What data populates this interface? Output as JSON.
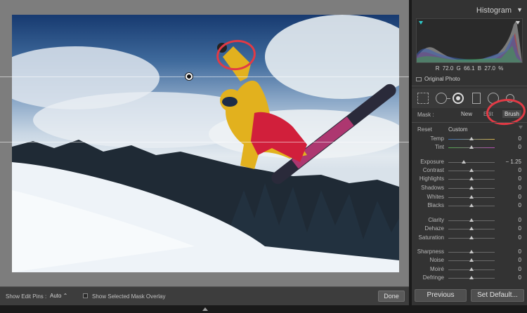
{
  "histogram": {
    "title": "Histogram",
    "toggle_icon": "triangle-down-icon",
    "r_label": "R",
    "r_value": "72.0",
    "g_label": "G",
    "g_value": "66.1",
    "b_label": "B",
    "b_value": "27.0",
    "unit": "%",
    "original_photo_label": "Original Photo"
  },
  "tools": [
    "crop-overlay-icon",
    "spot-removal-icon",
    "red-eye-icon",
    "graduated-filter-icon",
    "radial-filter-icon",
    "adjustment-brush-icon"
  ],
  "mask": {
    "label": "Mask :",
    "new": "New",
    "edit": "Edit",
    "brush": "Brush"
  },
  "adjust": {
    "reset_label": "Reset",
    "preset_value": "Custom",
    "sliders": [
      {
        "label": "Temp",
        "value": "0",
        "pos": 0.5
      },
      {
        "label": "Tint",
        "value": "0",
        "pos": 0.5
      },
      {
        "label": "Exposure",
        "value": "− 1.25",
        "pos": 0.34
      },
      {
        "label": "Contrast",
        "value": "0",
        "pos": 0.5
      },
      {
        "label": "Highlights",
        "value": "0",
        "pos": 0.5
      },
      {
        "label": "Shadows",
        "value": "0",
        "pos": 0.5
      },
      {
        "label": "Whites",
        "value": "0",
        "pos": 0.5
      },
      {
        "label": "Blacks",
        "value": "0",
        "pos": 0.5
      },
      {
        "label": "Clarity",
        "value": "0",
        "pos": 0.5
      },
      {
        "label": "Dehaze",
        "value": "0",
        "pos": 0.5
      },
      {
        "label": "Saturation",
        "value": "0",
        "pos": 0.5
      },
      {
        "label": "Sharpness",
        "value": "0",
        "pos": 0.5
      },
      {
        "label": "Noise",
        "value": "0",
        "pos": 0.5
      },
      {
        "label": "Moiré",
        "value": "0",
        "pos": 0.5
      },
      {
        "label": "Defringe",
        "value": "0",
        "pos": 0.5
      }
    ]
  },
  "toolbar": {
    "show_edit_pins_label": "Show Edit Pins :",
    "show_edit_pins_value": "Auto ⌃",
    "show_mask_overlay_label": "Show Selected Mask Overlay",
    "done_label": "Done"
  },
  "panel_buttons": {
    "previous_label": "Previous",
    "set_default_label": "Set Default..."
  },
  "colors": {
    "annotation": "#e23a45",
    "panel_bg": "#333333",
    "canvas_bg": "#7d7d7d"
  }
}
